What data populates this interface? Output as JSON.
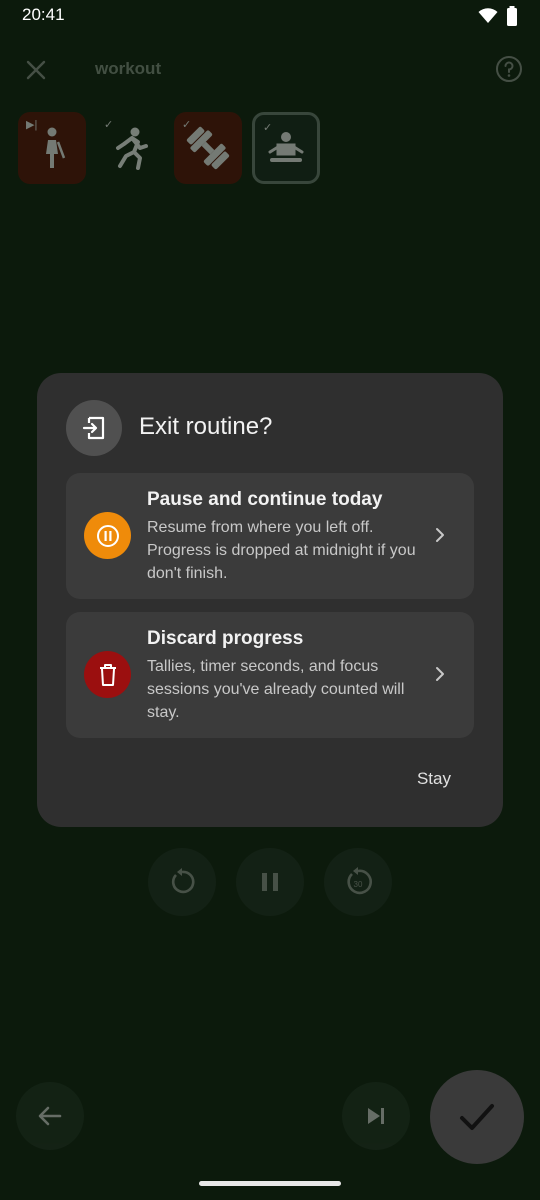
{
  "status_bar": {
    "time": "20:41"
  },
  "header": {
    "title": "workout"
  },
  "steps": [
    {
      "name": "walking",
      "badge": "▶|",
      "state": "current"
    },
    {
      "name": "running",
      "badge": "✓",
      "state": "done"
    },
    {
      "name": "weights",
      "badge": "✓",
      "state": "done"
    },
    {
      "name": "meditation",
      "badge": "✓",
      "state": "active"
    }
  ],
  "dialog": {
    "title": "Exit routine?",
    "pause_option": {
      "title": "Pause and continue today",
      "description": "Resume from where you left off. Progress is dropped at midnight if you don't finish."
    },
    "discard_option": {
      "title": "Discard progress",
      "description": "Tallies, timer seconds, and focus sessions you've already counted will stay."
    },
    "stay_label": "Stay"
  },
  "controls": {
    "rewind_label": "30"
  },
  "colors": {
    "pause_accent": "#ef8b0a",
    "discard_accent": "#9b0f0f",
    "background": "#0c1a0c",
    "dialog": "#2f2f2f"
  }
}
